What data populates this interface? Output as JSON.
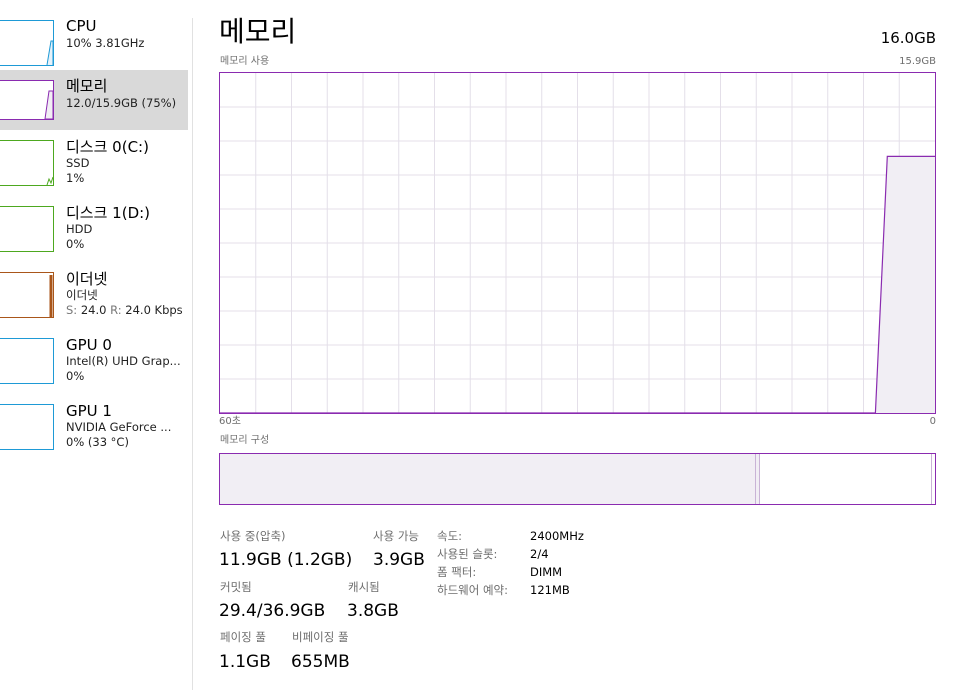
{
  "sidebar": {
    "items": [
      {
        "title": "CPU",
        "sub1": "10% 3.81GHz",
        "sub2": "",
        "color": "#1e9ad6"
      },
      {
        "title": "메모리",
        "sub1": "12.0/15.9GB (75%)",
        "sub2": "",
        "color": "#8a2bb0"
      },
      {
        "title": "디스크 0(C:)",
        "sub1": "SSD",
        "sub2": "1%",
        "color": "#4da81f"
      },
      {
        "title": "디스크 1(D:)",
        "sub1": "HDD",
        "sub2": "0%",
        "color": "#4da81f"
      },
      {
        "title": "이더넷",
        "sub1": "이더넷",
        "sub2": "",
        "color": "#a9561a"
      },
      {
        "title": "GPU 0",
        "sub1": "Intel(R) UHD Grap...",
        "sub2": "0%",
        "color": "#1e9ad6"
      },
      {
        "title": "GPU 1",
        "sub1": "NVIDIA GeForce ...",
        "sub2": "0% (33 °C)",
        "color": "#1e9ad6"
      }
    ],
    "ethernet_rate": {
      "s_label": "S:",
      "s_value": "24.0",
      "r_label": "R:",
      "r_value": "24.0 Kbps"
    }
  },
  "main": {
    "title": "메모리",
    "total": "16.0GB",
    "usage_label": "메모리 사용",
    "usage_max": "15.9GB",
    "time_left": "60초",
    "time_right": "0",
    "composition_label": "메모리 구성",
    "accent": "#8a2bb0",
    "fill": "#f1eef4"
  },
  "chart_data": {
    "type": "area",
    "x_label_left": "60초",
    "x_label_right": "0",
    "ylim": [
      0,
      15.9
    ],
    "y_unit": "GB",
    "grid": true,
    "series": [
      {
        "points_from_end_seconds": [
          [
            0,
            12.0
          ],
          [
            1,
            12.0
          ],
          [
            2,
            12.0
          ],
          [
            3,
            12.0
          ],
          [
            4,
            12.0
          ],
          [
            5,
            0
          ],
          [
            60,
            0
          ]
        ]
      }
    ]
  },
  "composition": {
    "in_use_fraction": 0.75,
    "modified_fraction": 0.005,
    "standby_fraction": 0.24,
    "free_fraction": 0.005
  },
  "stats": {
    "in_use": {
      "label": "사용 중(압축)",
      "value": "11.9GB (1.2GB)"
    },
    "available": {
      "label": "사용 가능",
      "value": "3.9GB"
    },
    "committed": {
      "label": "커밋됨",
      "value": "29.4/36.9GB"
    },
    "cached": {
      "label": "캐시됨",
      "value": "3.8GB"
    },
    "paged_pool": {
      "label": "페이징 풀",
      "value": "1.1GB"
    },
    "nonpaged_pool": {
      "label": "비페이징 풀",
      "value": "655MB"
    }
  },
  "specs": [
    {
      "key": "속도:",
      "value": "2400MHz"
    },
    {
      "key": "사용된 슬롯:",
      "value": "2/4"
    },
    {
      "key": "폼 팩터:",
      "value": "DIMM"
    },
    {
      "key": "하드웨어 예약:",
      "value": "121MB"
    }
  ]
}
